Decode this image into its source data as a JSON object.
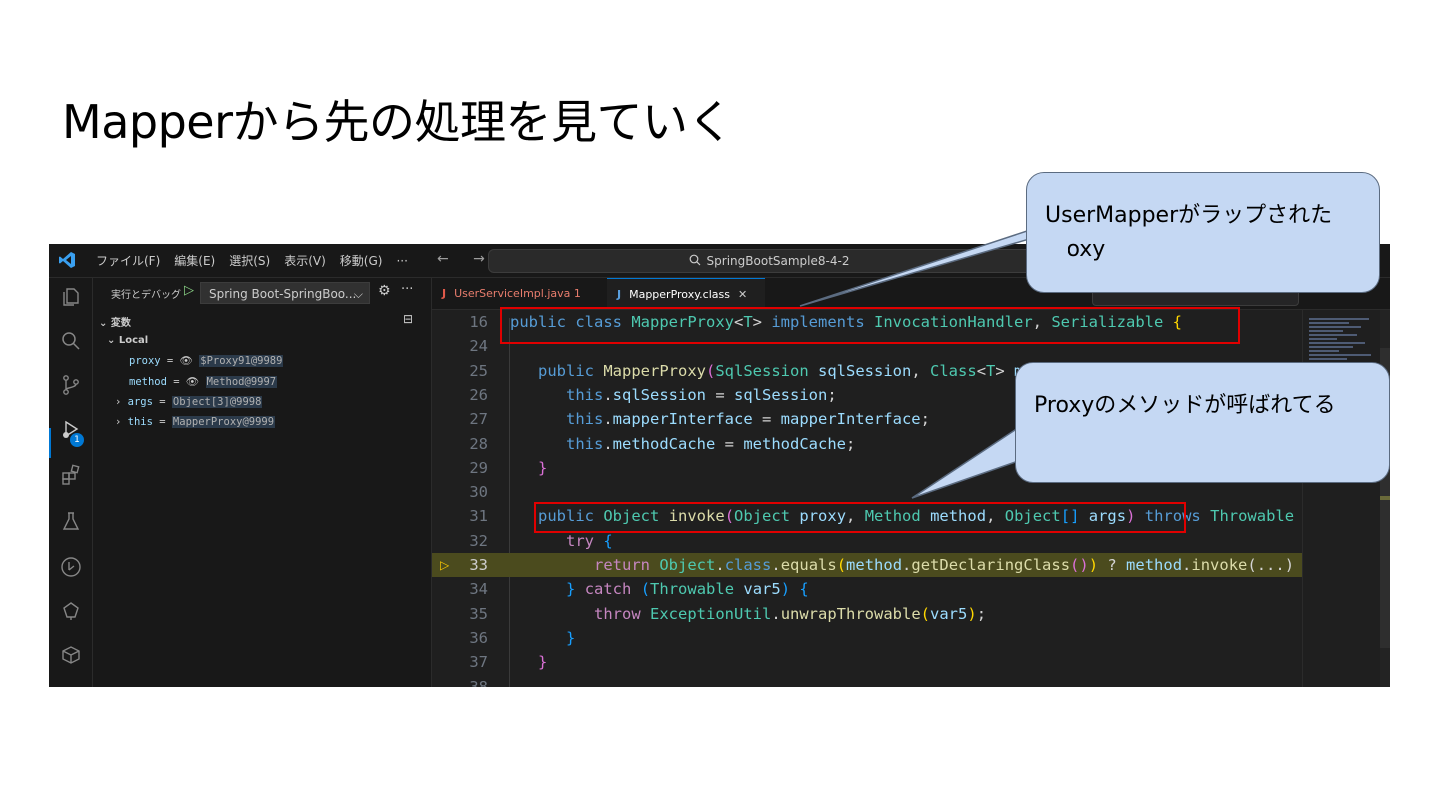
{
  "slide": {
    "title": "Mapperから先の処理を見ていく"
  },
  "titlebar": {
    "menus": [
      "ファイル(F)",
      "編集(E)",
      "選択(S)",
      "表示(V)",
      "移動(G)",
      "···"
    ],
    "nav_arrows": "← →",
    "search_text": "SpringBootSample8-4-2"
  },
  "sidebar": {
    "run_label": "実行とデバッグ",
    "run_config": "Spring Boot-SpringBoo...",
    "more": "···",
    "variables_header": "変数",
    "scope": "Local",
    "variables": [
      {
        "name": "proxy",
        "value": "$Proxy91@9989",
        "expandable": false,
        "eye": true
      },
      {
        "name": "method",
        "value": "Method@9997",
        "expandable": false,
        "eye": true
      },
      {
        "name": "args",
        "value": "Object[3]@9998",
        "expandable": true,
        "eye": false
      },
      {
        "name": "this",
        "value": "MapperProxy@9999",
        "expandable": true,
        "eye": false
      }
    ]
  },
  "activity": {
    "debug_badge": "1"
  },
  "editor": {
    "tabs": [
      {
        "label": "UserServiceImpl.java 1",
        "active": false
      },
      {
        "label": "MapperProxy.class",
        "active": true
      }
    ],
    "tab_icon": "J",
    "tab_close": "✕",
    "current_line": "33"
  },
  "callouts": {
    "proxy_wrapped": "UserMapperがラップされたProxy",
    "proxy_method": "Proxyのメソッドが呼ばれてる"
  },
  "colors": {
    "editor_bg": "#1f1f1f",
    "sidebar_bg": "#181818",
    "accent": "#0078d4",
    "highlight_red": "#e00000",
    "callout_fill": "#c5d8f3",
    "current_line_bg": "#4b4b1e"
  }
}
